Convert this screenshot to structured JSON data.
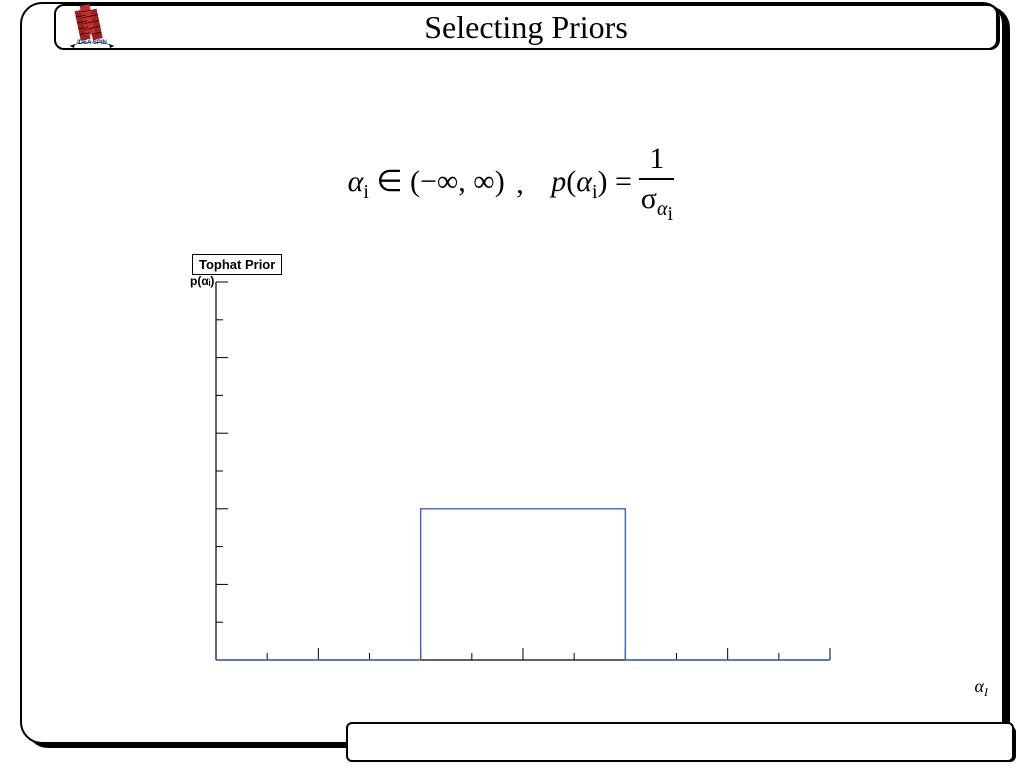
{
  "title": "Selecting Priors",
  "formula": {
    "alpha_sym": "α",
    "subscript": "i",
    "range_text": " ∈ (−∞, ∞) ",
    "comma": ",",
    "p_text": "p",
    "numerator": "1",
    "sigma": "σ"
  },
  "legend": "Tophat Prior",
  "ylabel": "p(αᵢ)",
  "xlabel_main": "α",
  "xlabel_sub": "I",
  "chart_data": {
    "type": "line",
    "title": "Tophat Prior",
    "xlabel": "αi",
    "ylabel": "p(αi)",
    "x_range": [
      -3,
      3
    ],
    "x_ticks_major": [
      -3,
      -2,
      -1,
      0,
      1,
      2,
      3
    ],
    "x_ticks_minor": [
      -2.5,
      -1.5,
      -0.5,
      0.5,
      1.5,
      2.5
    ],
    "y_range": [
      0,
      1
    ],
    "y_ticks_major": [
      0,
      0.2,
      0.4,
      0.6,
      0.8,
      1.0
    ],
    "series": [
      {
        "name": "Tophat Prior",
        "color": "#4060d0",
        "x": [
          -3,
          -1,
          -1,
          1,
          1,
          3
        ],
        "y": [
          0,
          0,
          0.4,
          0.4,
          0,
          0
        ]
      }
    ]
  }
}
